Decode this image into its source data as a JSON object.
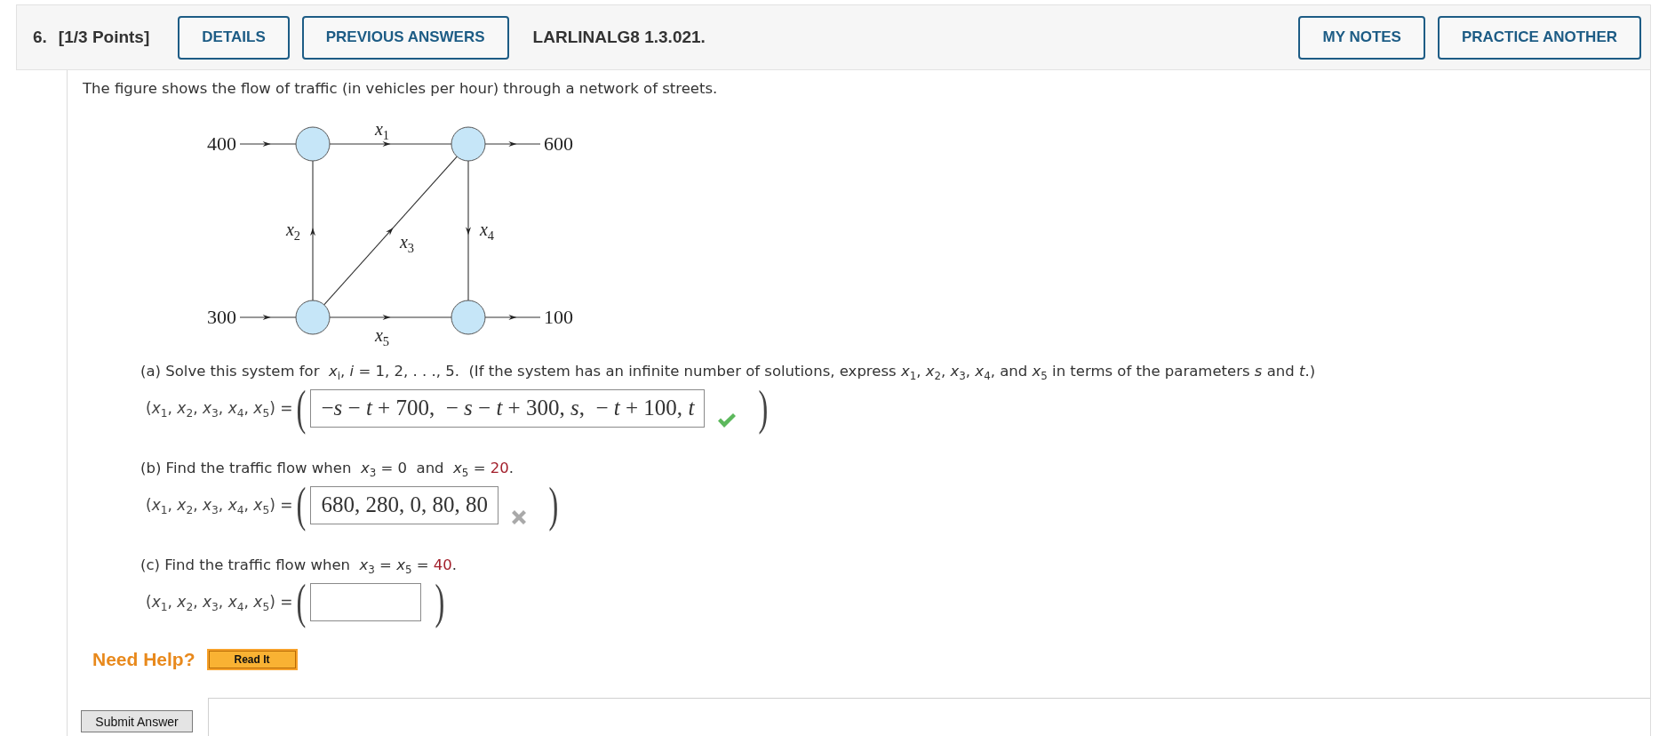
{
  "question": {
    "number": "6.",
    "points": "[1/3 Points]",
    "buttons_left": [
      {
        "label": "DETAILS"
      },
      {
        "label": "PREVIOUS ANSWERS"
      }
    ],
    "code": "LARLINALG8 1.3.021.",
    "buttons_right": [
      {
        "label": "MY NOTES"
      },
      {
        "label": "PRACTICE ANOTHER"
      }
    ]
  },
  "intro": "The figure shows the flow of traffic (in vehicles per hour) through a network of streets.",
  "figure": {
    "inflows": [
      {
        "label": "400"
      },
      {
        "label": "300"
      }
    ],
    "outflows": [
      {
        "label": "600"
      },
      {
        "label": "100"
      }
    ],
    "streets": [
      {
        "label": "*x*$_{1}$"
      },
      {
        "label": "*x*$_{2}$"
      },
      {
        "label": "*x*$_{3}$"
      },
      {
        "label": "*x*$_{4}$"
      },
      {
        "label": "*x*$_{5}$"
      }
    ]
  },
  "parts": [
    {
      "prompt": "(a) Solve this system for  *x*$_{i}$, *i* = 1, 2, . . ., 5.  (If the system has an infinite number of solutions, express *x*$_{1}$, *x*$_{2}$, *x*$_{3}$, *x*$_{4}$, and *x*$_{5}$ in terms of the parameters *s* and *t*.)",
      "answer": {
        "label": "(*x*$_{1}$, *x*$_{2}$, *x*$_{3}$, *x*$_{4}$, *x*$_{5}$) =",
        "open": "(",
        "value": "−*s* − *t* + 700,  − *s* − *t* + 300, *s*,  − *t* + 100, *t*",
        "graded": true,
        "correct": true,
        "close": ")"
      }
    },
    {
      "prompt": "(b) Find the traffic flow when  *x*$_{3}$ = 0  and  *x*$_{5}$ = ",
      "given": "20",
      "prompt_end": ".",
      "answer": {
        "label": "(*x*$_{1}$, *x*$_{2}$, *x*$_{3}$, *x*$_{4}$, *x*$_{5}$) =",
        "open": "(",
        "value": "680, 280, 0, 80, 80",
        "graded": true,
        "correct": false,
        "close": ")"
      }
    },
    {
      "prompt": "(c) Find the traffic flow when  *x*$_{3}$ = *x*$_{5}$ = ",
      "given": "40",
      "prompt_end": ".",
      "answer": {
        "label": "(*x*$_{1}$, *x*$_{2}$, *x*$_{3}$, *x*$_{4}$, *x*$_{5}$) =",
        "open": "(",
        "graded": false,
        "close": ")"
      }
    }
  ],
  "help": {
    "label": "Need Help?",
    "buttons": [
      {
        "label": "Read It"
      }
    ]
  },
  "submit": {
    "label": "Submit Answer"
  }
}
